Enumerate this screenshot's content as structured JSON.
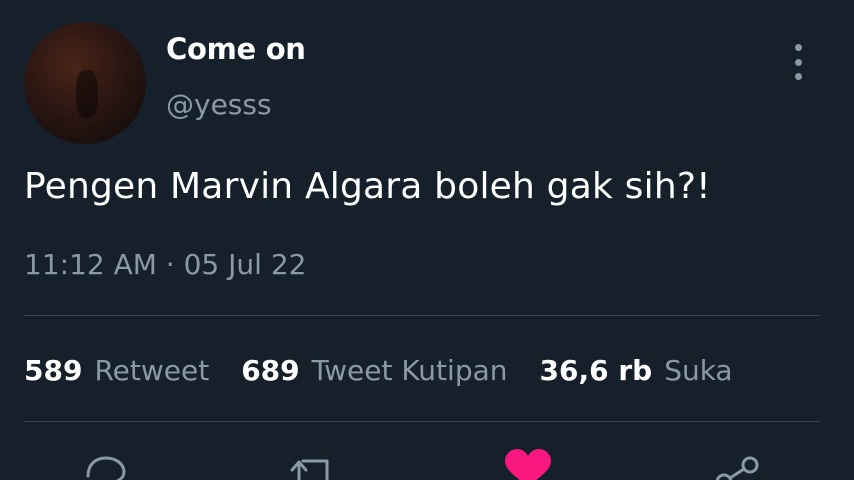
{
  "user": {
    "display_name": "Come on",
    "handle": "@yesss"
  },
  "tweet": {
    "text": "Pengen Marvin Algara boleh gak sih?!",
    "timestamp": "11:12 AM · 05 Jul 22"
  },
  "stats": {
    "retweets": {
      "count": "589",
      "label": "Retweet"
    },
    "quotes": {
      "count": "689",
      "label": "Tweet Kutipan"
    },
    "likes": {
      "count": "36,6 rb",
      "label": "Suka"
    }
  },
  "colors": {
    "background": "#15202b",
    "secondary_text": "#8b98a5",
    "divider": "#38444d",
    "like_active": "#f91880"
  },
  "icons": {
    "more": "more-vertical-icon",
    "reply": "reply-icon",
    "retweet": "retweet-icon",
    "like": "heart-icon",
    "share": "share-icon"
  }
}
